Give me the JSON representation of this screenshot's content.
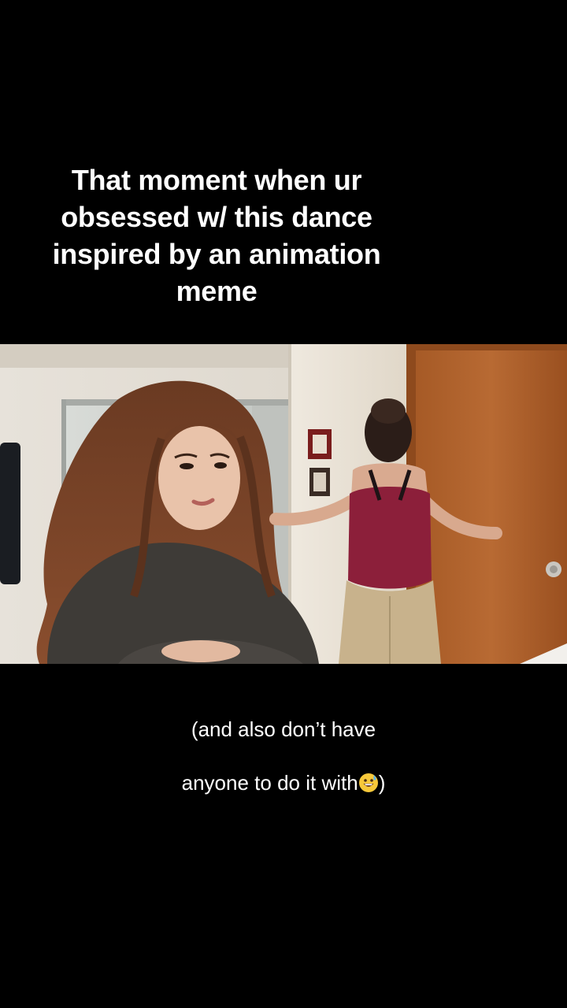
{
  "captions": {
    "top": "That moment when ur\nobsessed w/ this dance\ninspired by an animation\nmeme",
    "bottom_line1": "(and also don’t have",
    "bottom_line2_text": "anyone to do it with",
    "bottom_line2_close": ")"
  },
  "video": {
    "emoji_icon": "grinning-face-with-sweat-icon"
  }
}
